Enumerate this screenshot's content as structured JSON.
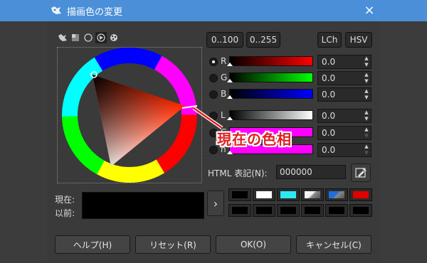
{
  "window": {
    "title": "描画色の変更",
    "close_icon": "×"
  },
  "mode_tabs": [
    "gimp-icon",
    "cmyk-icon",
    "watercolor-icon",
    "triangle-icon",
    "palette-icon"
  ],
  "scale_buttons": [
    "0..100",
    "0..255"
  ],
  "model_buttons": [
    "LCh",
    "HSV"
  ],
  "channels": [
    {
      "label": "R",
      "value": "0.0",
      "checked": true
    },
    {
      "label": "G",
      "value": "0.0",
      "checked": false
    },
    {
      "label": "B",
      "value": "0.0",
      "checked": false
    },
    {
      "label": "L",
      "value": "0.0",
      "checked": false
    },
    {
      "label": "C",
      "value": "0.0",
      "checked": false
    },
    {
      "label": "h",
      "value": "0.0",
      "checked": false
    }
  ],
  "html_notation": {
    "label": "HTML 表記(N):",
    "value": "000000"
  },
  "current_label": "現在:",
  "previous_label": "以前:",
  "history_arrow": "›",
  "history_colors": [
    "#000000",
    "#ffffff",
    "#2ee8f0",
    "#d8d8d8",
    "#1e6fe0",
    "#e00000",
    "#000000",
    "#000000",
    "#000000",
    "#000000",
    "#000000",
    "#000000"
  ],
  "buttons": {
    "help": "ヘルプ(H)",
    "reset": "リセット(R)",
    "ok": "OK(O)",
    "cancel": "キャンセル(C)"
  },
  "annotation": "現在の色相"
}
